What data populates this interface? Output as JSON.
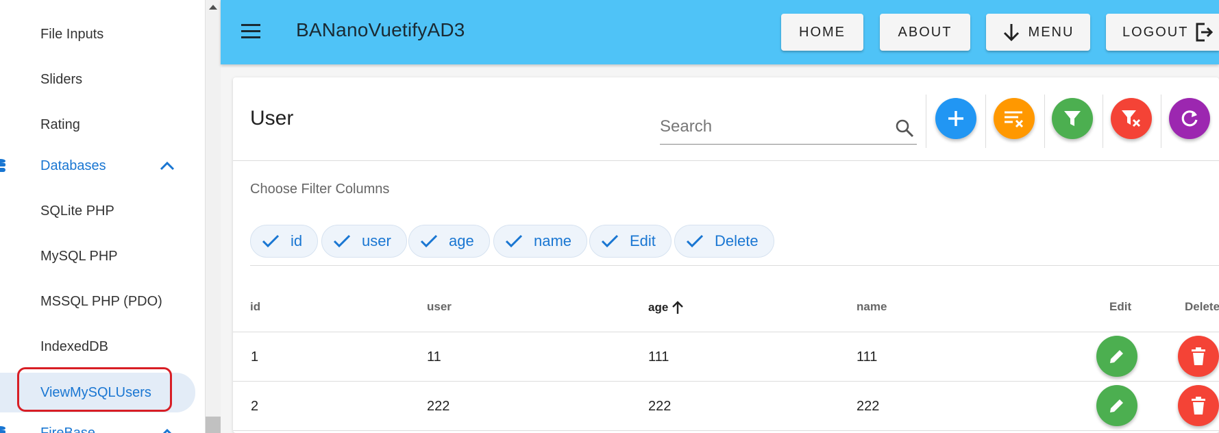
{
  "sidebar": {
    "items": [
      {
        "label": "File Inputs"
      },
      {
        "label": "Sliders"
      },
      {
        "label": "Rating"
      },
      {
        "label": "Databases"
      },
      {
        "label": "SQLite PHP"
      },
      {
        "label": "MySQL PHP"
      },
      {
        "label": "MSSQL PHP (PDO)"
      },
      {
        "label": "IndexedDB"
      },
      {
        "label": "ViewMySQLUsers"
      },
      {
        "label": "FireBase"
      }
    ],
    "active_item": "ViewMySQLUsers",
    "highlight_color": "#d81e25"
  },
  "appbar": {
    "title": "BANanoVuetifyAD3",
    "background": "#4fc3f7",
    "buttons": {
      "home": "HOME",
      "about": "ABOUT",
      "menu": "MENU",
      "logout": "LOGOUT"
    }
  },
  "card": {
    "title": "User",
    "search": {
      "placeholder": "Search"
    },
    "toolbar_colors": {
      "add": "#2196f3",
      "clear_sort": "#ff9800",
      "filter": "#4caf50",
      "clear_filter": "#f44336",
      "refresh": "#9c27b0"
    },
    "filter": {
      "label": "Choose Filter Columns",
      "chips": [
        "id",
        "user",
        "age",
        "name",
        "Edit",
        "Delete"
      ]
    },
    "table": {
      "headers": {
        "id": "id",
        "user": "user",
        "age": "age",
        "name": "name",
        "edit": "Edit",
        "delete": "Delete"
      },
      "sorted_by": "age",
      "rows": [
        {
          "id": "1",
          "user": "11",
          "age": "111",
          "name": "111"
        },
        {
          "id": "2",
          "user": "222",
          "age": "222",
          "name": "222"
        }
      ],
      "edit_color": "#4caf50",
      "delete_color": "#f44336"
    }
  }
}
